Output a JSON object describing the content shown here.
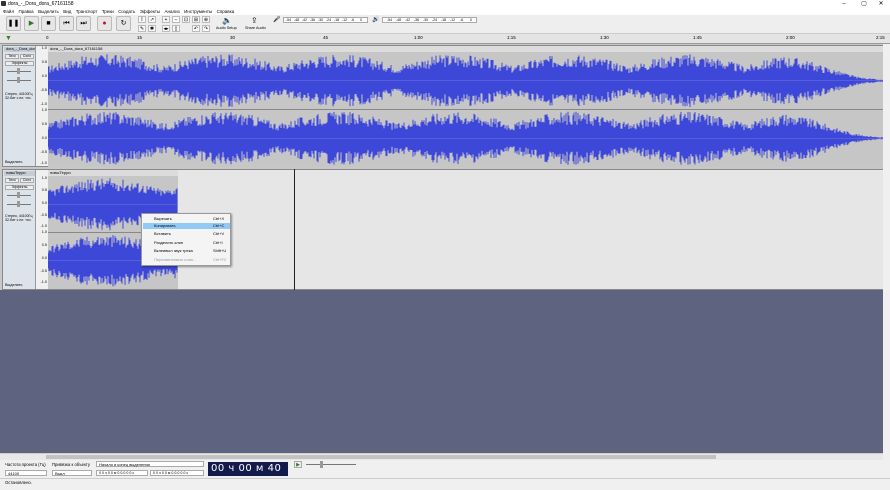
{
  "window": {
    "title": "dora_-_Dora_dora_67161158"
  },
  "menubar": [
    "Файл",
    "Правка",
    "Выделить",
    "Вид",
    "Транспорт",
    "Треки",
    "Создать",
    "Эффекты",
    "Анализ",
    "Инструменты",
    "Справка"
  ],
  "toolbar": {
    "audio_setup": "Audio Setup",
    "share_audio": "Share Audio",
    "meter_ticks_play": [
      "-54",
      "-48",
      "-42",
      "-36",
      "-30",
      "-24",
      "-18",
      "-12",
      "-6",
      "0"
    ],
    "meter_ticks_rec": [
      "-54",
      "-48",
      "-42",
      "-36",
      "-30",
      "-24",
      "-18",
      "-12",
      "-6",
      "0"
    ],
    "record_color": "#c8102e"
  },
  "timeline": {
    "ticks": [
      "0",
      "15",
      "30",
      "45",
      "1:00",
      "1:15",
      "1:30",
      "1:45",
      "2:00",
      "2:15"
    ]
  },
  "tracks": [
    {
      "name": "dora_-_Dora_dora_67161158",
      "clip_name": "dora_-_Dora_dora_67161158",
      "mute": "Тихо",
      "solo": "Соло",
      "effects": "Эффекты",
      "info": "Стерео, 44100Гц\n32-бит с пл. точ.",
      "select": "Выделить",
      "scale": [
        "1.0",
        "0.5",
        "0.0",
        "-0.5",
        "-1.0",
        "1.0",
        "0.5",
        "0.0",
        "-0.5",
        "-1.0"
      ]
    },
    {
      "name": "новыТерри",
      "clip_name": "новыТерри",
      "mute": "Тихо",
      "solo": "Соло",
      "effects": "Эффекты",
      "info": "Стерео, 44100Гц\n32-бит с пл. точ.",
      "select": "Выделить",
      "scale": [
        "1.0",
        "0.5",
        "0.0",
        "-0.5",
        "-1.0",
        "1.0",
        "0.5",
        "0.0",
        "-0.5",
        "-1.0"
      ]
    }
  ],
  "context_menu": {
    "items": [
      {
        "label": "Вырезать",
        "shortcut": "Ctrl+X"
      },
      {
        "label": "Копировать",
        "shortcut": "Ctrl+C"
      },
      {
        "label": "Вставить",
        "shortcut": "Ctrl+V"
      },
      {
        "label": "Разделить клип",
        "shortcut": "Ctrl+I"
      },
      {
        "label": "Вклеивыл звук трека",
        "shortcut": "Shift+U"
      },
      {
        "label": "Переименовать клип...",
        "shortcut": "Ctrl+F2"
      }
    ]
  },
  "selection_toolbar": {
    "project_rate_label": "Частота проекта (Гц)",
    "project_rate_value": "44100",
    "snap_label": "Привязка к объекту",
    "snap_value": "Выкл",
    "selection_label": "Начало и конец выделения",
    "sel_start": "0 0 ч 0 0 м 0 0.0 0 0 с",
    "sel_end": "0 0 ч 0 0 м 0 0.0 0 0 с",
    "time": "00 ч 00 м 40 с"
  },
  "status": {
    "text": "Остановлено."
  },
  "colors": {
    "waveform": "#3e48d8",
    "waveform_bg": "#c6c6c6",
    "selected_bg": "#e6e6e6",
    "empty_area": "#5e6380"
  }
}
